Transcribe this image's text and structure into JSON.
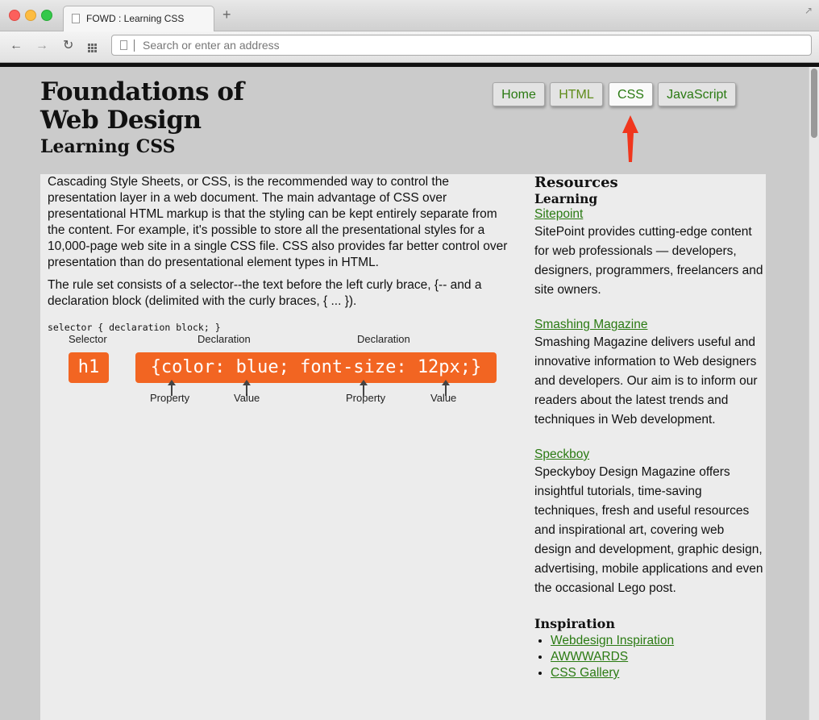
{
  "browser": {
    "tab_title": "FOWD : Learning CSS",
    "new_tab": "+",
    "resize_icon": "↗",
    "back_icon": "←",
    "forward_icon": "→",
    "reload_icon": "↻",
    "address_placeholder": "Search or enter an address"
  },
  "header": {
    "title": "Foundations of Web Design",
    "subtitle": "Learning CSS"
  },
  "nav": {
    "items": [
      {
        "label": "Home"
      },
      {
        "label": "HTML"
      },
      {
        "label": "CSS"
      },
      {
        "label": "JavaScript"
      }
    ],
    "active": "CSS",
    "active_indicator": "red-arrow"
  },
  "content": {
    "paragraph1": "Cascading Style Sheets, or CSS, is the recommended way to control the presentation layer in a web document. The main advantage of CSS over presentational HTML markup is that the styling can be kept entirely separate from the content. For example, it's possible to store all the presentational styles for a 10,000-page web site in a single CSS file. CSS also provides far better control over presentation than do presentational element types in HTML.",
    "paragraph2": "The rule set consists of a selector--the text before the left curly brace, {-- and a declaration block (delimited with the curly braces, { ... }).",
    "code": "selector { declaration block; }",
    "diagram": {
      "selector_label": "Selector",
      "declaration_label_1": "Declaration",
      "declaration_label_2": "Declaration",
      "selector_text": "h1",
      "declaration_text": "{color: blue; font-size: 12px;}",
      "property_label_1": "Property",
      "value_label_1": "Value",
      "property_label_2": "Property",
      "value_label_2": "Value"
    }
  },
  "sidebar": {
    "heading": "Resources",
    "learning_heading": "Learning",
    "learning": [
      {
        "name": "Sitepoint",
        "desc": "SitePoint provides cutting-edge content for web professionals — developers, designers, programmers, freelancers and site owners."
      },
      {
        "name": "Smashing Magazine",
        "desc": "Smashing Magazine delivers useful and innovative information to Web designers and developers. Our aim is to inform our readers about the latest trends and techniques in Web development."
      },
      {
        "name": "Speckboy",
        "desc": "Speckyboy Design Magazine offers insightful tutorials, time-saving techniques, fresh and useful resources and inspirational art, covering web design and development, graphic design, advertising, mobile applications and even the occasional Lego post."
      }
    ],
    "inspiration_heading": "Inspiration",
    "inspiration": [
      "Webdesign Inspiration",
      "AWWWARDS",
      "CSS Gallery"
    ]
  },
  "colors": {
    "link": "#2a7a12",
    "diagram_orange": "#f26522",
    "arrow_red": "#f0361d"
  }
}
